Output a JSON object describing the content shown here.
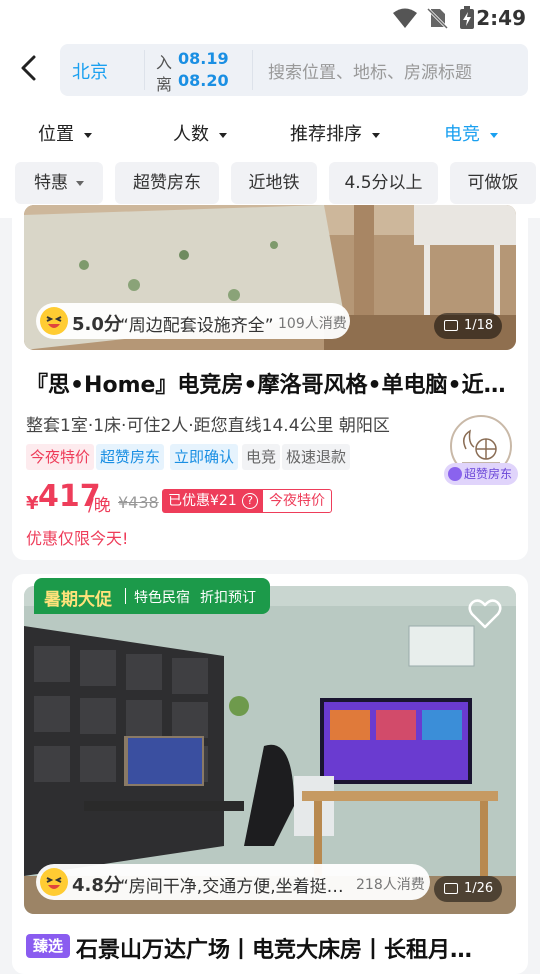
{
  "status": {
    "time": "2:49"
  },
  "search": {
    "city": "北京",
    "checkin_label": "入",
    "checkin_date": "08.19",
    "checkout_label": "离",
    "checkout_date": "08.20",
    "placeholder": "搜索位置、地标、房源标题"
  },
  "filters": [
    {
      "label": "位置",
      "active": false
    },
    {
      "label": "人数",
      "active": false
    },
    {
      "label": "推荐排序",
      "active": false
    },
    {
      "label": "电竞",
      "active": true
    }
  ],
  "chips": [
    "特惠",
    "超赞房东",
    "近地铁",
    "4.5分以上",
    "可做饭"
  ],
  "listings": [
    {
      "score": "5.0分",
      "review_quote": "“周边配套设施齐全”",
      "consumers": "109人消费",
      "photo_counter": "1/18",
      "title": "『思•Home』电竞房•摩洛哥风格•单电脑•近…",
      "subtitle": "整套1室·1床·可住2人·距您直线14.4公里 朝阳区",
      "tags": [
        "今夜特价",
        "超赞房东",
        "立即确认",
        "电竞",
        "极速退款"
      ],
      "host_badge": "超赞房东",
      "currency": "¥",
      "price": "417",
      "price_unit": "/晚",
      "original_price": "¥438",
      "discount": "已优惠¥21",
      "discount_info_icon": "?",
      "promo_tag": "今夜特价",
      "notice": "优惠仅限今天!"
    },
    {
      "banner_main": "暑期大促",
      "banner_sub1": "特色民宿",
      "banner_sub2": "折扣预订",
      "score": "4.8分",
      "review_quote": "“房间干净,交通方便,坐着挺…",
      "consumers": "218人消费",
      "photo_counter": "1/26",
      "badge": "臻选",
      "title": "石景山万达广场丨电竞大床房丨长租月…"
    }
  ],
  "colors": {
    "accent": "#1aa0f0",
    "price": "#ee3d5a",
    "banner": "#1c9a4a"
  }
}
